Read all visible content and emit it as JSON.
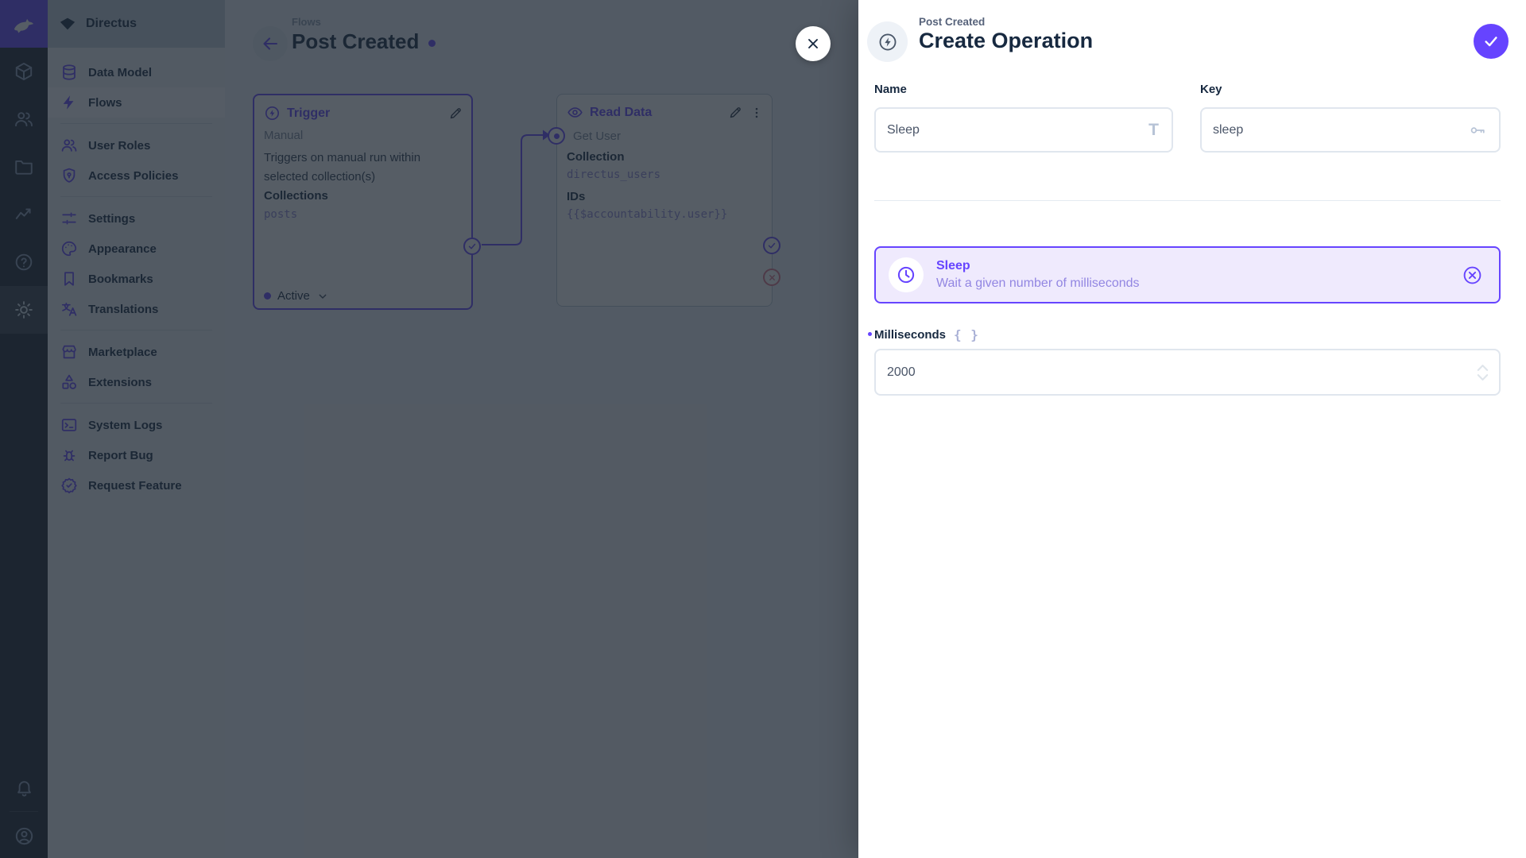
{
  "colors": {
    "accent": "#6644ff",
    "accent_light": "#efeafd",
    "text_dark": "#172940",
    "modulebar_bg": "#18222f"
  },
  "sidebar": {
    "project_name": "Directus",
    "nav": {
      "items": [
        "Data Model",
        "Flows",
        "User Roles",
        "Access Policies",
        "Settings",
        "Appearance",
        "Bookmarks",
        "Translations",
        "Marketplace",
        "Extensions",
        "System Logs",
        "Report Bug",
        "Request Feature"
      ]
    }
  },
  "canvas": {
    "breadcrumb": "Flows",
    "title": "Post Created",
    "trigger": {
      "title": "Trigger",
      "type": "Manual",
      "desc": "Triggers on manual run within selected collection(s)",
      "collections_label": "Collections",
      "collections_value": "posts",
      "status": "Active"
    },
    "read": {
      "title": "Read Data",
      "name": "Get User",
      "collection_label": "Collection",
      "collection_value": "directus_users",
      "ids_label": "IDs",
      "ids_value": "{{$accountability.user}}"
    }
  },
  "drawer": {
    "breadcrumb": "Post Created",
    "title": "Create Operation",
    "fields": {
      "name_label": "Name",
      "name_value": "Sleep",
      "key_label": "Key",
      "key_value": "sleep",
      "ms_label": "Milliseconds",
      "ms_value": "2000"
    },
    "operation": {
      "name": "Sleep",
      "desc": "Wait a given number of milliseconds"
    }
  }
}
